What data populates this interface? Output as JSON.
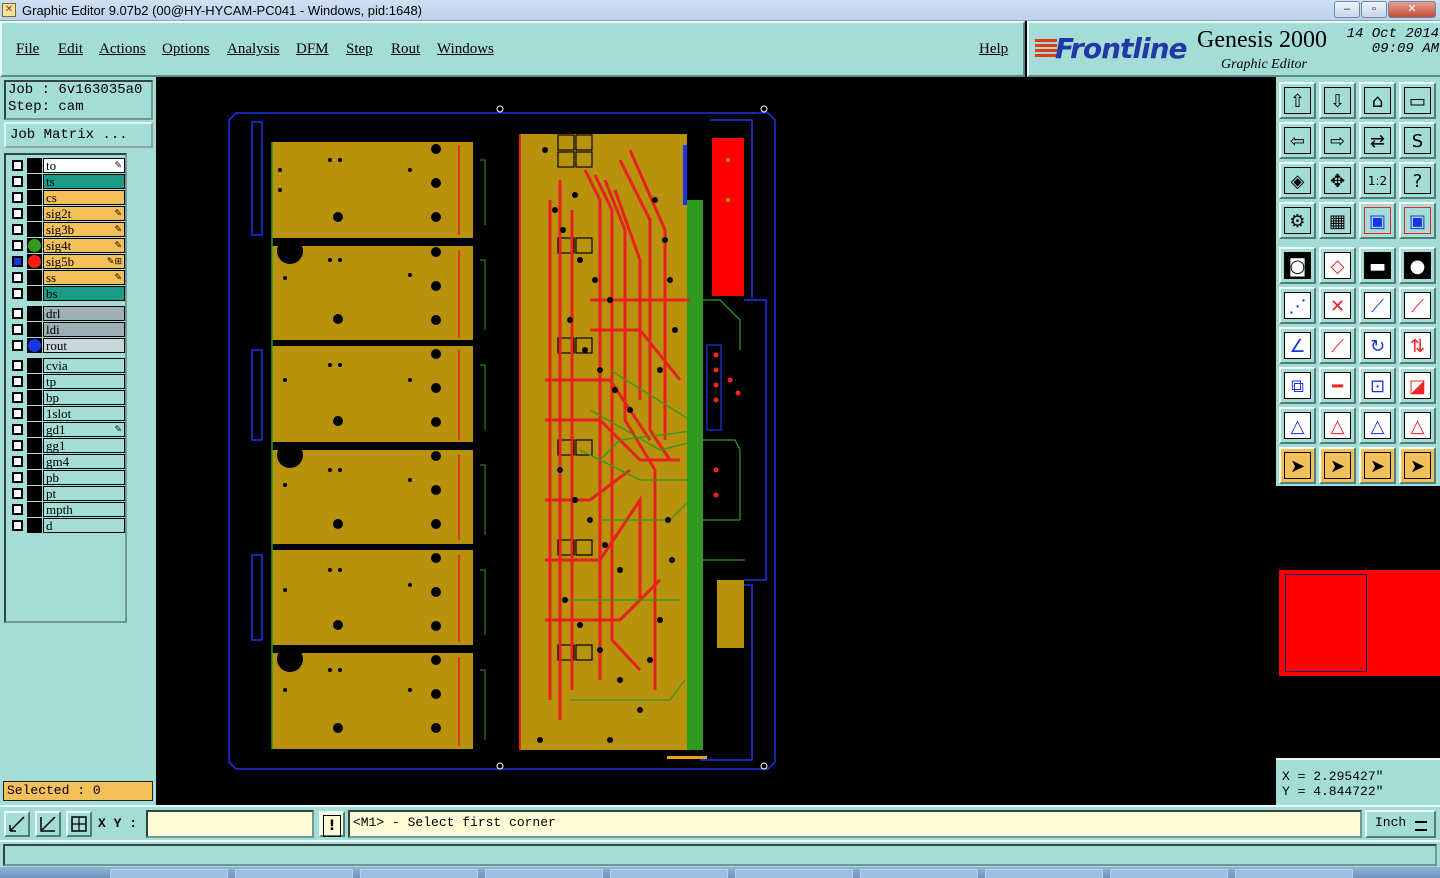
{
  "window": {
    "title": "Graphic Editor 9.07b2 (00@HY-HYCAM-PC041 - Windows, pid:1648)",
    "minimize": "–",
    "maximize": "▫",
    "close": "✕"
  },
  "menu": {
    "file": "File",
    "edit": "Edit",
    "actions": "Actions",
    "options": "Options",
    "analysis": "Analysis",
    "dfm": "DFM",
    "step": "Step",
    "rout": "Rout",
    "windows": "Windows",
    "help": "Help"
  },
  "brand": {
    "logo": "Frontline",
    "product": "Genesis 2000",
    "subtitle": "Graphic Editor",
    "date": "14 Oct 2014",
    "time": "09:09 AM"
  },
  "job": {
    "job_line": "Job : 6v163035a0",
    "step_line": "Step: cam",
    "matrix_button": "Job Matrix ..."
  },
  "layers": [
    {
      "name": "to",
      "color": "#ffffff",
      "dot": null,
      "mark": "✎"
    },
    {
      "name": "ts",
      "color": "#1b9a86",
      "dot": null,
      "mark": ""
    },
    {
      "name": "cs",
      "color": "#f4c05a",
      "dot": null,
      "mark": ""
    },
    {
      "name": "sig2t",
      "color": "#f4c05a",
      "dot": null,
      "mark": "✎"
    },
    {
      "name": "sig3b",
      "color": "#f4c05a",
      "dot": null,
      "mark": "✎"
    },
    {
      "name": "sig4t",
      "color": "#f4c05a",
      "dot": "#2e9a1e",
      "mark": "✎"
    },
    {
      "name": "sig5b",
      "color": "#f4c05a",
      "dot": "#ff1a1a",
      "mark": "✎⊞",
      "active": true
    },
    {
      "name": "ss",
      "color": "#f4c05a",
      "dot": null,
      "mark": "✎"
    },
    {
      "name": "bs",
      "color": "#1b9a86",
      "dot": null,
      "mark": ""
    },
    {
      "name": "drl",
      "color": "#9fb0b5",
      "dot": null,
      "mark": ""
    },
    {
      "name": "ldi",
      "color": "#9fb0b5",
      "dot": null,
      "mark": ""
    },
    {
      "name": "rout",
      "color": "#c8d7da",
      "dot": "#1a35e8",
      "mark": ""
    },
    {
      "name": "cvia",
      "color": "#a4ddd6",
      "dot": null,
      "mark": ""
    },
    {
      "name": "tp",
      "color": "#a4ddd6",
      "dot": null,
      "mark": ""
    },
    {
      "name": "bp",
      "color": "#a4ddd6",
      "dot": null,
      "mark": ""
    },
    {
      "name": "1slot",
      "color": "#a4ddd6",
      "dot": null,
      "mark": ""
    },
    {
      "name": "gd1",
      "color": "#a4ddd6",
      "dot": null,
      "mark": "✎"
    },
    {
      "name": "gg1",
      "color": "#a4ddd6",
      "dot": null,
      "mark": ""
    },
    {
      "name": "gm4",
      "color": "#a4ddd6",
      "dot": null,
      "mark": ""
    },
    {
      "name": "pb",
      "color": "#a4ddd6",
      "dot": null,
      "mark": ""
    },
    {
      "name": "pt",
      "color": "#a4ddd6",
      "dot": null,
      "mark": ""
    },
    {
      "name": "mpth",
      "color": "#a4ddd6",
      "dot": null,
      "mark": ""
    },
    {
      "name": "d",
      "color": "#a4ddd6",
      "dot": null,
      "mark": ""
    }
  ],
  "selected": "Selected : 0",
  "coords": {
    "x": "X = 2.295427\"",
    "y": "Y = 4.844722\""
  },
  "bottom": {
    "xy_label": "X Y :",
    "xy_value": "",
    "alert": "!",
    "prompt": "<M1> - Select first corner",
    "unit": "Inch"
  },
  "tools": [
    "zoom-home-icon",
    "zoom-fit-icon",
    "home-view-icon",
    "window-icon",
    "pan-left-icon",
    "pan-right-icon",
    "mirror-icon",
    "snake-icon",
    "zoom-in-icon",
    "zoom-out-icon",
    "ratio-icon",
    "help-icon",
    "measure-icon",
    "grid-icon",
    "layer-red-icon",
    "layer-red2-icon",
    "pad-icon",
    "slope-icon",
    "ruler-icon",
    "dot-icon",
    "nodes-icon",
    "cross-icon",
    "line-red-icon",
    "line-blue-icon",
    "angle-icon",
    "diagonal-icon",
    "rotate-icon",
    "flip-icon",
    "copy-icon",
    "bar-icon",
    "center-icon",
    "shapes-icon",
    "triangle1-icon",
    "triangle2-icon",
    "triangle3-icon",
    "triangle4-icon",
    "pointer-icon",
    "pointer-box-icon",
    "pointer-circle-icon",
    "pointer-path-icon"
  ]
}
